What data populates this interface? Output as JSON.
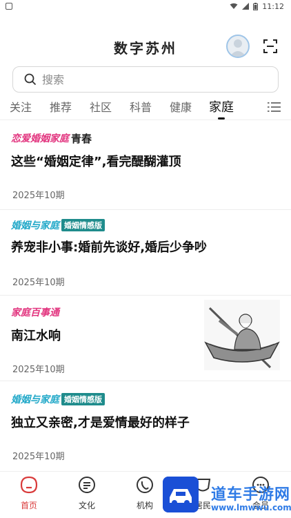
{
  "status_bar": {
    "time": "11:12"
  },
  "header": {
    "title": "数字苏州"
  },
  "search": {
    "placeholder": "搜索"
  },
  "tabs": [
    {
      "label": "关注"
    },
    {
      "label": "推荐"
    },
    {
      "label": "社区"
    },
    {
      "label": "科普"
    },
    {
      "label": "健康"
    },
    {
      "label": "家庭",
      "active": true
    }
  ],
  "articles": [
    {
      "logo": {
        "brand": "恋爱婚姻家庭",
        "sub": "青春"
      },
      "title": "这些“婚姻定律”,看完醍醐灌顶",
      "issue": "2025年10期"
    },
    {
      "logo": {
        "brand": "婚姻与家庭",
        "badge": "婚姻情感版"
      },
      "title": "养宠非小事:婚前先谈好,婚后少争吵",
      "issue": "2025年10期"
    },
    {
      "logo": {
        "brand": "家庭百事通"
      },
      "title": "南江水响",
      "issue": "2025年10期",
      "has_thumbnail": true
    },
    {
      "logo": {
        "brand": "婚姻与家庭",
        "badge": "婚姻情感版"
      },
      "title": "独立又亲密,才是爱情最好的样子",
      "issue": "2025年10期"
    }
  ],
  "bottom_nav": [
    {
      "label": "首页",
      "icon": "home-icon",
      "active": true
    },
    {
      "label": "文化",
      "icon": "document-icon"
    },
    {
      "label": "机构",
      "icon": "phone-icon"
    },
    {
      "label": "居民",
      "icon": "mask-icon"
    },
    {
      "label": "会员",
      "icon": "chat-icon"
    }
  ],
  "watermark": {
    "text": "道车手游网",
    "url": "www.lmwwu.com"
  },
  "colors": {
    "active_tab": "#111111",
    "nav_active": "#d93a3a",
    "logo_pink": "#e2357f",
    "logo_cyan": "#23a9c9",
    "badge_teal": "#1f8c8c",
    "watermark_blue": "#2f7be6"
  }
}
